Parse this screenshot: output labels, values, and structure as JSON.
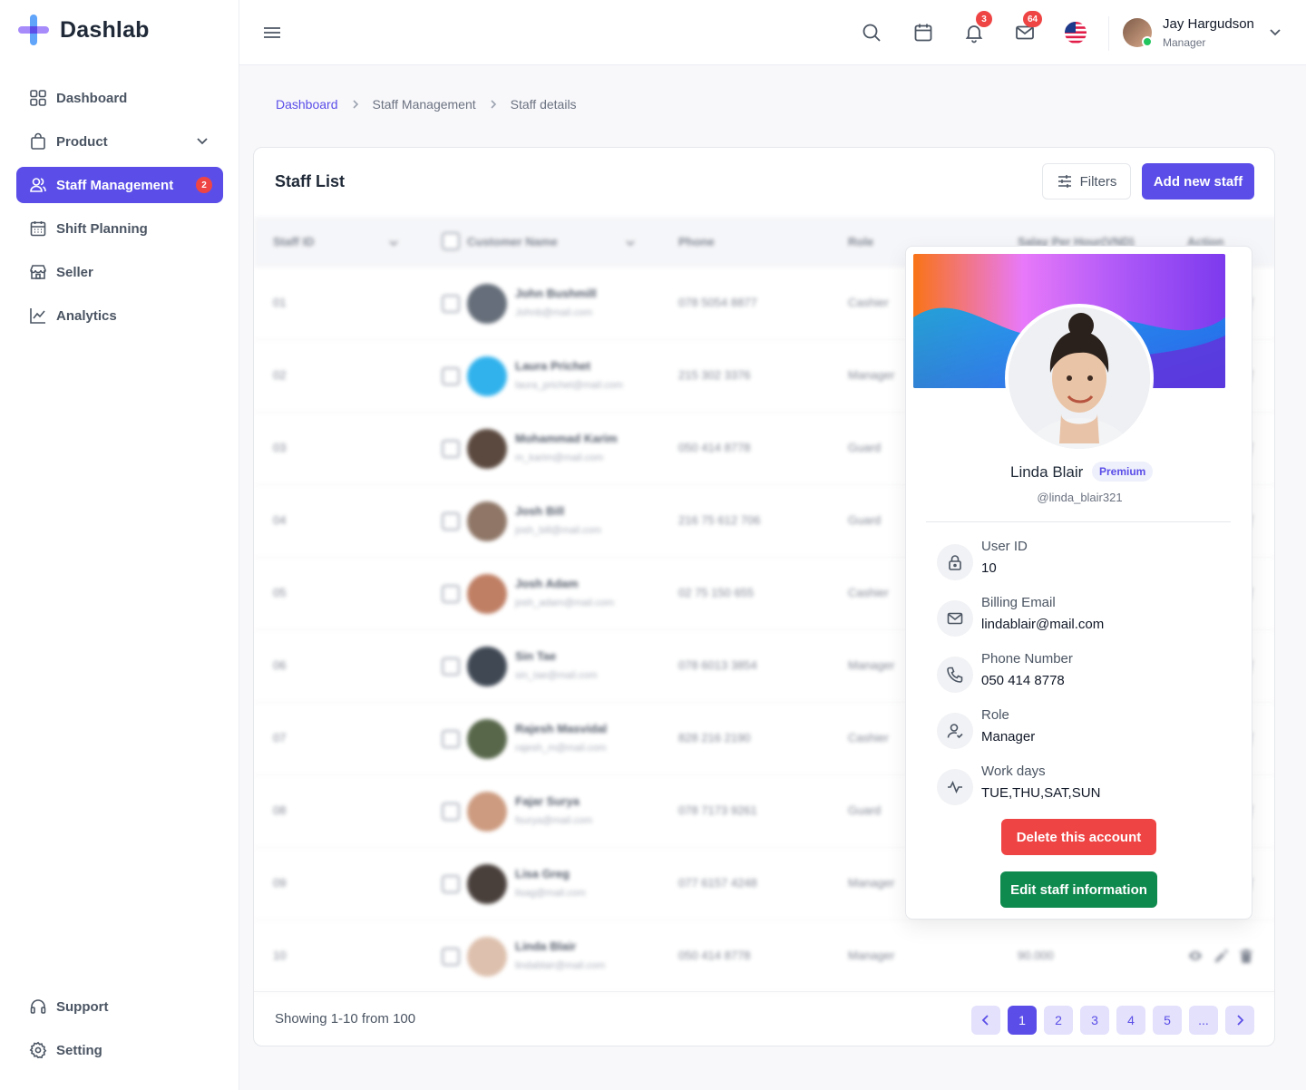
{
  "app": {
    "name": "Dashlab"
  },
  "sidebar": {
    "items": [
      {
        "label": "Dashboard",
        "icon": "grid-icon"
      },
      {
        "label": "Product",
        "icon": "bag-icon"
      },
      {
        "label": "Staff Management",
        "icon": "users-icon",
        "badge": "2"
      },
      {
        "label": "Shift Planning",
        "icon": "calendar-icon"
      },
      {
        "label": "Seller",
        "icon": "store-icon"
      },
      {
        "label": "Analytics",
        "icon": "chart-icon"
      }
    ],
    "bottom": [
      {
        "label": "Support",
        "icon": "headset-icon"
      },
      {
        "label": "Setting",
        "icon": "gear-icon"
      }
    ]
  },
  "topbar": {
    "notifications_count": "3",
    "messages_count": "64",
    "user": {
      "name": "Jay Hargudson",
      "role": "Manager"
    }
  },
  "breadcrumb": [
    "Dashboard",
    "Staff Management",
    "Staff details"
  ],
  "card": {
    "title": "Staff List",
    "filters_label": "Filters",
    "add_label": "Add new staff"
  },
  "table": {
    "columns": [
      "Staff ID",
      "Customer Name",
      "Phone",
      "Role",
      "Salay Per Hour(VND)",
      "Action"
    ],
    "rows": [
      {
        "id": "01",
        "name": "John Bushmill",
        "email": "Johnb@mail.com",
        "phone": "078 5054 8877",
        "role": "Cashier",
        "salary": ""
      },
      {
        "id": "02",
        "name": "Laura Prichet",
        "email": "laura_prichet@mail.com",
        "phone": "215 302 3376",
        "role": "Manager",
        "salary": ""
      },
      {
        "id": "03",
        "name": "Mohammad Karim",
        "email": "m_karim@mail.com",
        "phone": "050 414 8778",
        "role": "Guard",
        "salary": ""
      },
      {
        "id": "04",
        "name": "Josh Bill",
        "email": "josh_bill@mail.com",
        "phone": "216 75 612 706",
        "role": "Guard",
        "salary": ""
      },
      {
        "id": "05",
        "name": "Josh Adam",
        "email": "josh_adam@mail.com",
        "phone": "02 75 150 655",
        "role": "Cashier",
        "salary": ""
      },
      {
        "id": "06",
        "name": "Sin Tae",
        "email": "sin_tae@mail.com",
        "phone": "078 6013 3854",
        "role": "Manager",
        "salary": ""
      },
      {
        "id": "07",
        "name": "Rajesh Masvidal",
        "email": "rajesh_m@mail.com",
        "phone": "828 216 2190",
        "role": "Cashier",
        "salary": ""
      },
      {
        "id": "08",
        "name": "Fajar Surya",
        "email": "fsurya@mail.com",
        "phone": "078 7173 9261",
        "role": "Guard",
        "salary": ""
      },
      {
        "id": "09",
        "name": "Lisa Greg",
        "email": "lisag@mail.com",
        "phone": "077 6157 4248",
        "role": "Manager",
        "salary": ""
      },
      {
        "id": "10",
        "name": "Linda Blair",
        "email": "lindablair@mail.com",
        "phone": "050 414 8778",
        "role": "Manager",
        "salary": "90.000"
      }
    ]
  },
  "footer": {
    "showing": "Showing 1-10 from 100",
    "pages": [
      "1",
      "2",
      "3",
      "4",
      "5",
      "..."
    ]
  },
  "profile": {
    "name": "Linda Blair",
    "badge": "Premium",
    "handle": "@linda_blair321",
    "fields": [
      {
        "label": "User ID",
        "value": "10",
        "icon": "lock-icon"
      },
      {
        "label": "Billing Email",
        "value": "lindablair@mail.com",
        "icon": "mail-icon"
      },
      {
        "label": "Phone Number",
        "value": "050 414 8778",
        "icon": "phone-icon"
      },
      {
        "label": "Role",
        "value": "Manager",
        "icon": "user-check-icon"
      },
      {
        "label": "Work days",
        "value": "TUE,THU,SAT,SUN",
        "icon": "activity-icon"
      }
    ],
    "delete_label": "Delete this account",
    "edit_label": "Edit staff information"
  },
  "colors": {
    "accent": "#5b4ee8",
    "danger": "#ef4444",
    "success": "#0f8a4f"
  }
}
